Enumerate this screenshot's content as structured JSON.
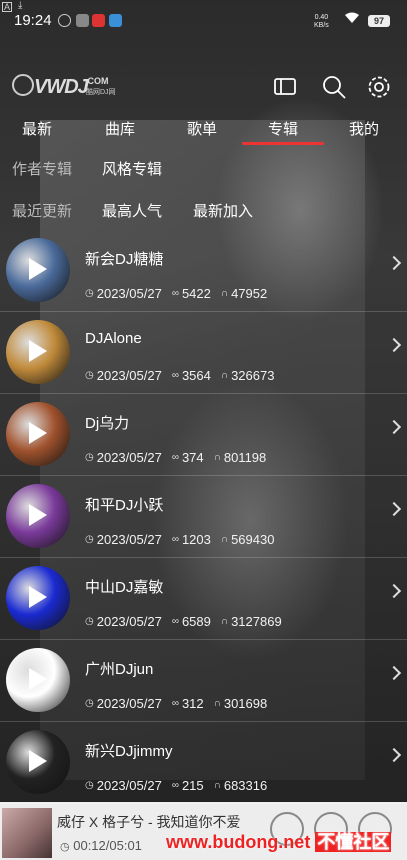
{
  "status_bar": {
    "time": "19:24",
    "net_speed_value": "0.40",
    "net_speed_unit": "KB/s",
    "battery": "97"
  },
  "header": {
    "logo_text": "VWDJ",
    "logo_domain": ".COM",
    "logo_sub": "酷网DJ网"
  },
  "tabs": [
    {
      "label": "最新"
    },
    {
      "label": "曲库"
    },
    {
      "label": "歌单"
    },
    {
      "label": "专辑",
      "active": true
    },
    {
      "label": "我的"
    }
  ],
  "filters_row1": [
    {
      "label": "作者专辑",
      "active": false
    },
    {
      "label": "风格专辑",
      "active": true
    }
  ],
  "filters_row2": [
    {
      "label": "最近更新",
      "active": false
    },
    {
      "label": "最高人气",
      "active": true
    },
    {
      "label": "最新加入",
      "active": true
    }
  ],
  "albums": [
    {
      "name": "新会DJ糖糖",
      "date": "2023/05/27",
      "count": "5422",
      "plays": "47952",
      "color": "#4a6a9a"
    },
    {
      "name": "DJAlone",
      "date": "2023/05/27",
      "count": "3564",
      "plays": "326673",
      "color": "#c08a3a"
    },
    {
      "name": "Dj乌力",
      "date": "2023/05/27",
      "count": "374",
      "plays": "801198",
      "color": "#a0522d"
    },
    {
      "name": "和平DJ小跃",
      "date": "2023/05/27",
      "count": "1203",
      "plays": "569430",
      "color": "#7a3a9a"
    },
    {
      "name": "中山DJ嘉敏",
      "date": "2023/05/27",
      "count": "6589",
      "plays": "3127869",
      "color": "#1a2ad0"
    },
    {
      "name": "广州DJjun",
      "date": "2023/05/27",
      "count": "312",
      "plays": "301698",
      "color": "#ffffff"
    },
    {
      "name": "新兴DJjimmy",
      "date": "2023/05/27",
      "count": "215",
      "plays": "683316",
      "color": "#222222"
    }
  ],
  "player": {
    "song": "威仔 X 格子兮 - 我知道你不爱",
    "time": "00:12/05:01"
  },
  "watermark": {
    "url": "www.budong.net",
    "brand": "不懂社区"
  }
}
